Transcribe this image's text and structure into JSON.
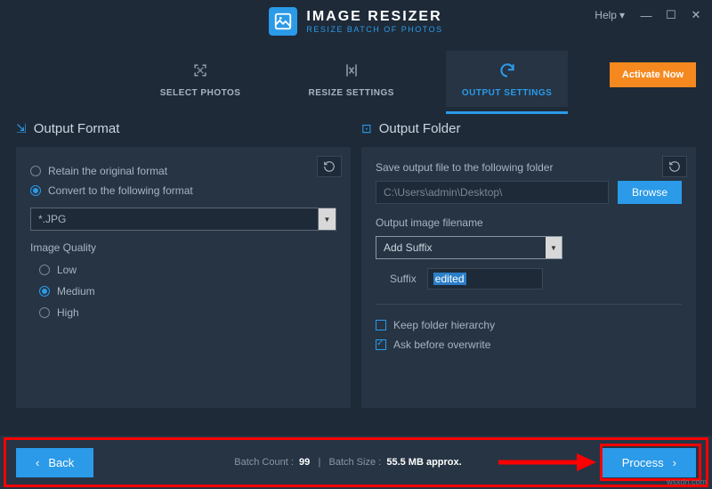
{
  "titlebar": {
    "logo_title": "IMAGE RESIZER",
    "logo_subtitle": "RESIZE BATCH OF PHOTOS",
    "help_label": "Help"
  },
  "tabs": {
    "select_photos": "SELECT PHOTOS",
    "resize_settings": "RESIZE SETTINGS",
    "output_settings": "OUTPUT SETTINGS"
  },
  "activate_label": "Activate Now",
  "output_format": {
    "title": "Output Format",
    "retain_label": "Retain the original format",
    "convert_label": "Convert to the following format",
    "format_value": "*.JPG",
    "quality_label": "Image Quality",
    "low": "Low",
    "medium": "Medium",
    "high": "High"
  },
  "output_folder": {
    "title": "Output Folder",
    "save_label": "Save output file to the following folder",
    "path_value": "C:\\Users\\admin\\Desktop\\",
    "browse_label": "Browse",
    "filename_label": "Output image filename",
    "filename_mode": "Add Suffix",
    "suffix_label": "Suffix",
    "suffix_value": "edited",
    "keep_hierarchy": "Keep folder hierarchy",
    "ask_overwrite": "Ask before overwrite"
  },
  "footer": {
    "back_label": "Back",
    "batch_count_label": "Batch Count :",
    "batch_count_value": "99",
    "batch_size_label": "Batch Size :",
    "batch_size_value": "55.5 MB approx.",
    "process_label": "Process"
  },
  "watermark": "wsxdn.com"
}
